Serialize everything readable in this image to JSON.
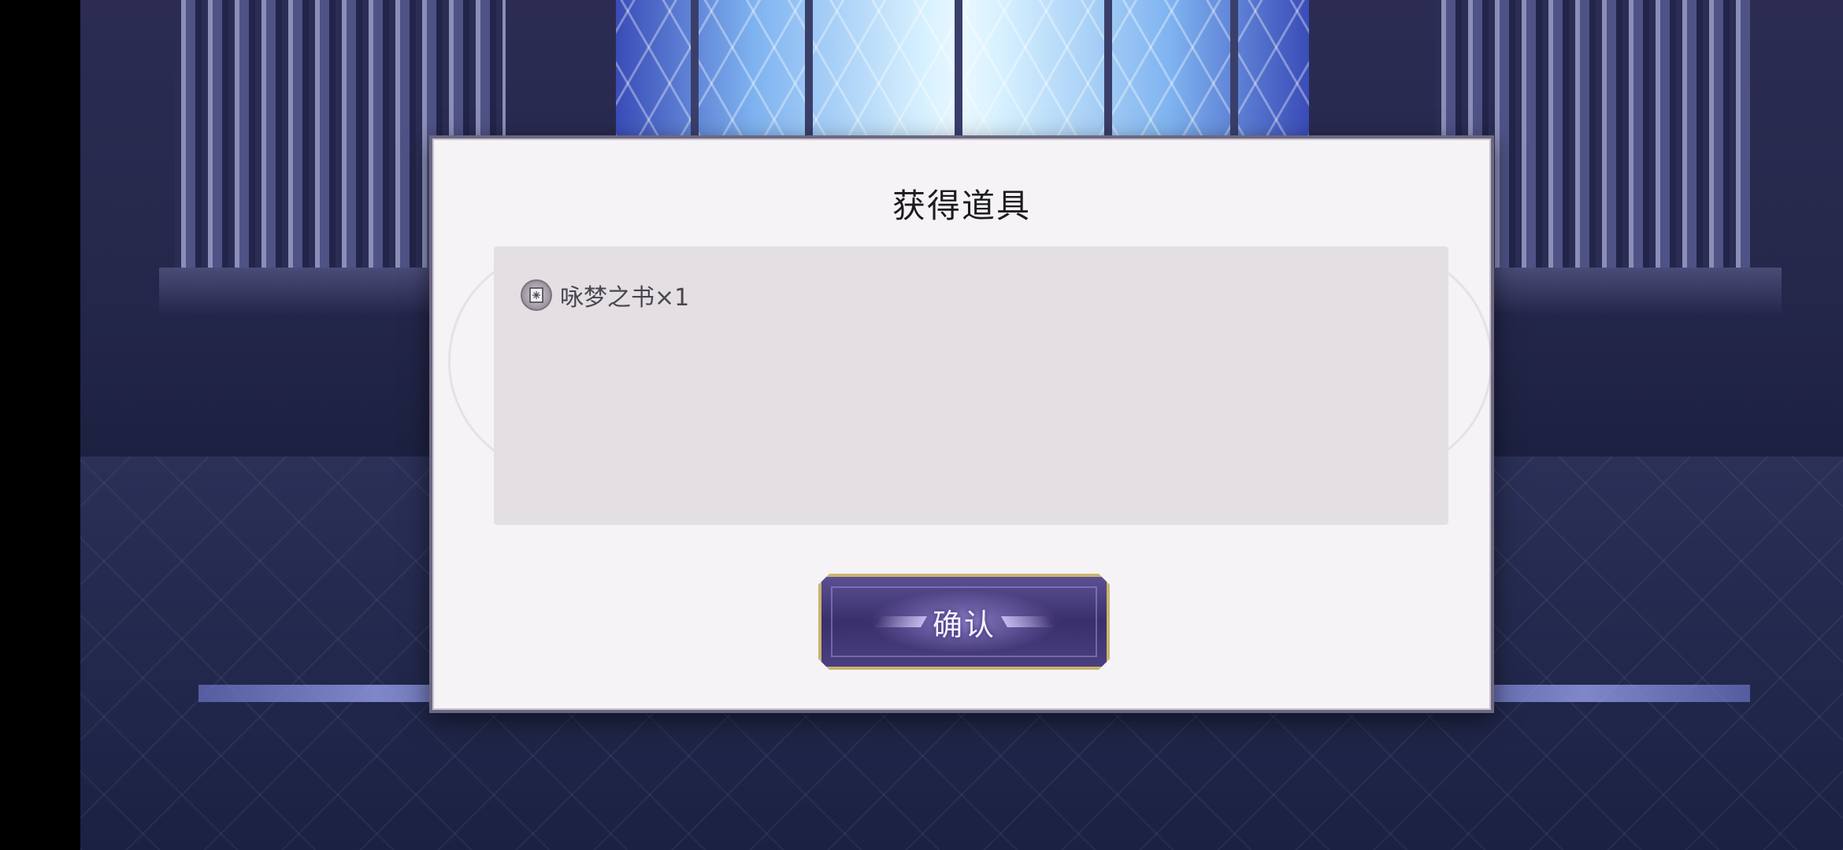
{
  "dialog": {
    "title": "获得道具",
    "items": [
      {
        "name": "咏梦之书",
        "count_text": "×1",
        "icon": "book-icon"
      }
    ],
    "confirm_label": "确认"
  },
  "colors": {
    "dialog_bg": "#f5f3f5",
    "panel_bg": "#e4dfe2",
    "button_bg": "#3a2f6c",
    "button_border": "#c9b46e"
  }
}
